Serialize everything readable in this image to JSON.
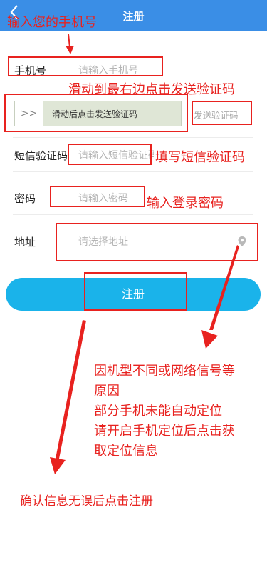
{
  "header": {
    "title": "注册",
    "back_icon": "chevron-left-icon",
    "color": "#3a8ee6"
  },
  "form": {
    "phone_label": "手机号",
    "phone_placeholder": "请输入手机号",
    "slider_handle": ">>",
    "slider_text": "滑动后点击发送验证码",
    "send_code_label": "发送验证码",
    "sms_label": "短信验证码",
    "sms_placeholder": "请输入短信验证码",
    "password_label": "密码",
    "password_placeholder": "请输入密码",
    "address_label": "地址",
    "address_placeholder": "请选择地址",
    "location_icon": "location-pin-icon"
  },
  "register_button": {
    "label": "注册",
    "color": "#1ab3ea"
  },
  "annotations": {
    "enter_phone": "输入您的手机号",
    "slide_right": "滑动到最右边点击发送验证码",
    "fill_sms": "填写短信验证码",
    "enter_password": "输入登录密码",
    "location_note_1": "因机型不同或网络信号等",
    "location_note_2": "原因",
    "location_note_3": "部分手机未能自动定位",
    "location_note_4": "请开启手机定位后点击获",
    "location_note_5": "取定位信息",
    "confirm": "确认信息无误后点击注册",
    "color": "#e8221f"
  }
}
